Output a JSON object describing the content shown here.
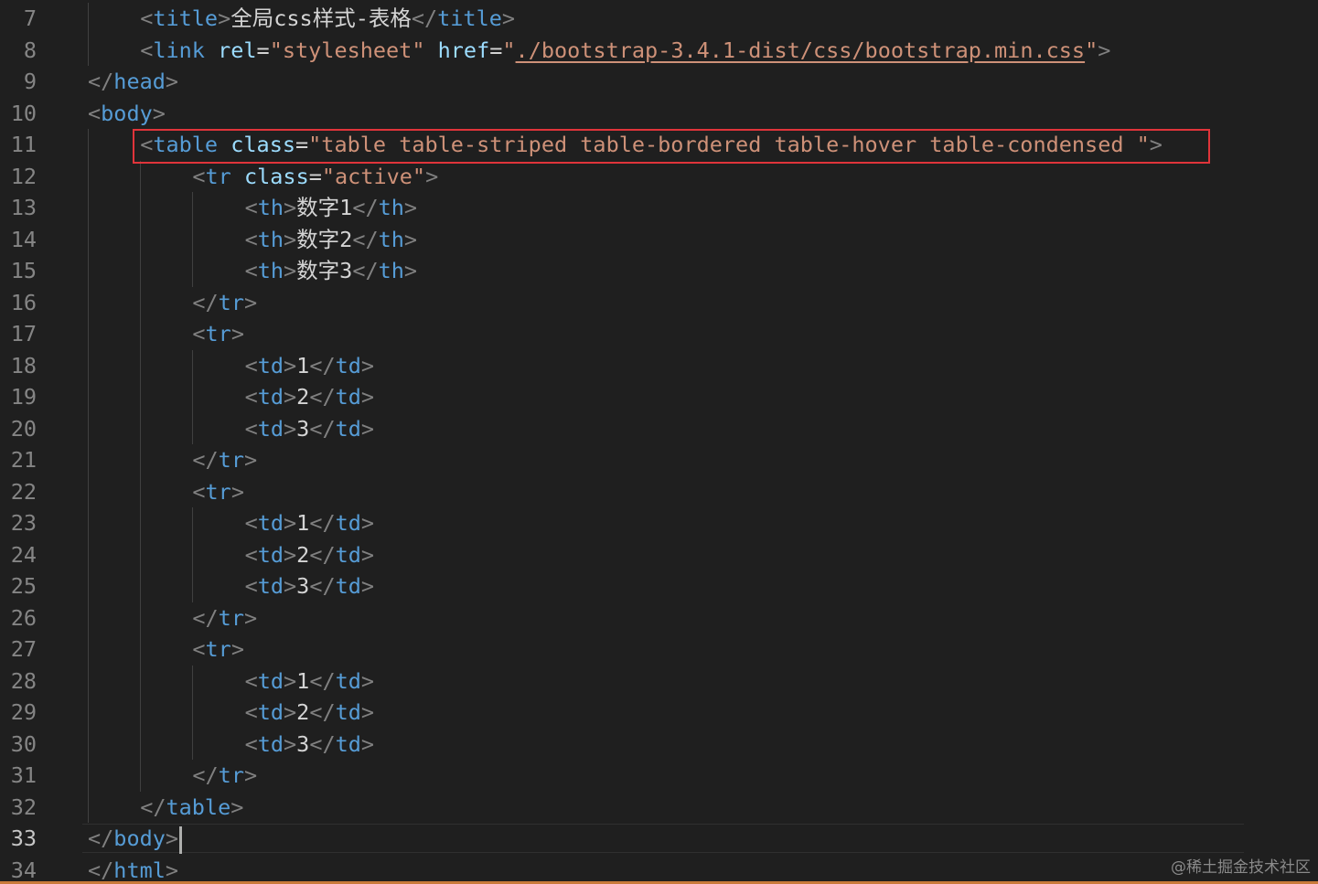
{
  "editor": {
    "current_line": "33",
    "lines": [
      {
        "n": "7",
        "indent": 1,
        "guides": 1,
        "tokens": [
          [
            "punct",
            "<"
          ],
          [
            "tag",
            "title"
          ],
          [
            "punct",
            ">"
          ],
          [
            "txt",
            "全局css样式-表格"
          ],
          [
            "punct",
            "</"
          ],
          [
            "tag",
            "title"
          ],
          [
            "punct",
            ">"
          ]
        ]
      },
      {
        "n": "8",
        "indent": 1,
        "guides": 1,
        "tokens": [
          [
            "punct",
            "<"
          ],
          [
            "tag",
            "link"
          ],
          [
            "txt",
            " "
          ],
          [
            "attr",
            "rel"
          ],
          [
            "eq",
            "="
          ],
          [
            "str",
            "\"stylesheet\""
          ],
          [
            "txt",
            " "
          ],
          [
            "attr",
            "href"
          ],
          [
            "eq",
            "="
          ],
          [
            "str",
            "\""
          ],
          [
            "link",
            "./bootstrap-3.4.1-dist/css/bootstrap.min.css"
          ],
          [
            "str",
            "\""
          ],
          [
            "punct",
            ">"
          ]
        ]
      },
      {
        "n": "9",
        "indent": 0,
        "guides": 0,
        "tokens": [
          [
            "punct",
            "</"
          ],
          [
            "tag",
            "head"
          ],
          [
            "punct",
            ">"
          ]
        ]
      },
      {
        "n": "10",
        "indent": 0,
        "guides": 0,
        "tokens": [
          [
            "punct",
            "<"
          ],
          [
            "tag",
            "body"
          ],
          [
            "punct",
            ">"
          ]
        ]
      },
      {
        "n": "11",
        "indent": 1,
        "guides": 1,
        "tokens": [
          [
            "punct",
            "<"
          ],
          [
            "tag",
            "table"
          ],
          [
            "txt",
            " "
          ],
          [
            "attr",
            "class"
          ],
          [
            "eq",
            "="
          ],
          [
            "str",
            "\"table table-striped table-bordered table-hover table-condensed \""
          ],
          [
            "punct",
            ">"
          ]
        ]
      },
      {
        "n": "12",
        "indent": 2,
        "guides": 2,
        "tokens": [
          [
            "punct",
            "<"
          ],
          [
            "tag",
            "tr"
          ],
          [
            "txt",
            " "
          ],
          [
            "attr",
            "class"
          ],
          [
            "eq",
            "="
          ],
          [
            "str",
            "\"active\""
          ],
          [
            "punct",
            ">"
          ]
        ]
      },
      {
        "n": "13",
        "indent": 3,
        "guides": 3,
        "tokens": [
          [
            "punct",
            "<"
          ],
          [
            "tag",
            "th"
          ],
          [
            "punct",
            ">"
          ],
          [
            "txt",
            "数字1"
          ],
          [
            "punct",
            "</"
          ],
          [
            "tag",
            "th"
          ],
          [
            "punct",
            ">"
          ]
        ]
      },
      {
        "n": "14",
        "indent": 3,
        "guides": 3,
        "tokens": [
          [
            "punct",
            "<"
          ],
          [
            "tag",
            "th"
          ],
          [
            "punct",
            ">"
          ],
          [
            "txt",
            "数字2"
          ],
          [
            "punct",
            "</"
          ],
          [
            "tag",
            "th"
          ],
          [
            "punct",
            ">"
          ]
        ]
      },
      {
        "n": "15",
        "indent": 3,
        "guides": 3,
        "tokens": [
          [
            "punct",
            "<"
          ],
          [
            "tag",
            "th"
          ],
          [
            "punct",
            ">"
          ],
          [
            "txt",
            "数字3"
          ],
          [
            "punct",
            "</"
          ],
          [
            "tag",
            "th"
          ],
          [
            "punct",
            ">"
          ]
        ]
      },
      {
        "n": "16",
        "indent": 2,
        "guides": 2,
        "tokens": [
          [
            "punct",
            "</"
          ],
          [
            "tag",
            "tr"
          ],
          [
            "punct",
            ">"
          ]
        ]
      },
      {
        "n": "17",
        "indent": 2,
        "guides": 2,
        "tokens": [
          [
            "punct",
            "<"
          ],
          [
            "tag",
            "tr"
          ],
          [
            "punct",
            ">"
          ]
        ]
      },
      {
        "n": "18",
        "indent": 3,
        "guides": 3,
        "tokens": [
          [
            "punct",
            "<"
          ],
          [
            "tag",
            "td"
          ],
          [
            "punct",
            ">"
          ],
          [
            "txt",
            "1"
          ],
          [
            "punct",
            "</"
          ],
          [
            "tag",
            "td"
          ],
          [
            "punct",
            ">"
          ]
        ]
      },
      {
        "n": "19",
        "indent": 3,
        "guides": 3,
        "tokens": [
          [
            "punct",
            "<"
          ],
          [
            "tag",
            "td"
          ],
          [
            "punct",
            ">"
          ],
          [
            "txt",
            "2"
          ],
          [
            "punct",
            "</"
          ],
          [
            "tag",
            "td"
          ],
          [
            "punct",
            ">"
          ]
        ]
      },
      {
        "n": "20",
        "indent": 3,
        "guides": 3,
        "tokens": [
          [
            "punct",
            "<"
          ],
          [
            "tag",
            "td"
          ],
          [
            "punct",
            ">"
          ],
          [
            "txt",
            "3"
          ],
          [
            "punct",
            "</"
          ],
          [
            "tag",
            "td"
          ],
          [
            "punct",
            ">"
          ]
        ]
      },
      {
        "n": "21",
        "indent": 2,
        "guides": 2,
        "tokens": [
          [
            "punct",
            "</"
          ],
          [
            "tag",
            "tr"
          ],
          [
            "punct",
            ">"
          ]
        ]
      },
      {
        "n": "22",
        "indent": 2,
        "guides": 2,
        "tokens": [
          [
            "punct",
            "<"
          ],
          [
            "tag",
            "tr"
          ],
          [
            "punct",
            ">"
          ]
        ]
      },
      {
        "n": "23",
        "indent": 3,
        "guides": 3,
        "tokens": [
          [
            "punct",
            "<"
          ],
          [
            "tag",
            "td"
          ],
          [
            "punct",
            ">"
          ],
          [
            "txt",
            "1"
          ],
          [
            "punct",
            "</"
          ],
          [
            "tag",
            "td"
          ],
          [
            "punct",
            ">"
          ]
        ]
      },
      {
        "n": "24",
        "indent": 3,
        "guides": 3,
        "tokens": [
          [
            "punct",
            "<"
          ],
          [
            "tag",
            "td"
          ],
          [
            "punct",
            ">"
          ],
          [
            "txt",
            "2"
          ],
          [
            "punct",
            "</"
          ],
          [
            "tag",
            "td"
          ],
          [
            "punct",
            ">"
          ]
        ]
      },
      {
        "n": "25",
        "indent": 3,
        "guides": 3,
        "tokens": [
          [
            "punct",
            "<"
          ],
          [
            "tag",
            "td"
          ],
          [
            "punct",
            ">"
          ],
          [
            "txt",
            "3"
          ],
          [
            "punct",
            "</"
          ],
          [
            "tag",
            "td"
          ],
          [
            "punct",
            ">"
          ]
        ]
      },
      {
        "n": "26",
        "indent": 2,
        "guides": 2,
        "tokens": [
          [
            "punct",
            "</"
          ],
          [
            "tag",
            "tr"
          ],
          [
            "punct",
            ">"
          ]
        ]
      },
      {
        "n": "27",
        "indent": 2,
        "guides": 2,
        "tokens": [
          [
            "punct",
            "<"
          ],
          [
            "tag",
            "tr"
          ],
          [
            "punct",
            ">"
          ]
        ]
      },
      {
        "n": "28",
        "indent": 3,
        "guides": 3,
        "tokens": [
          [
            "punct",
            "<"
          ],
          [
            "tag",
            "td"
          ],
          [
            "punct",
            ">"
          ],
          [
            "txt",
            "1"
          ],
          [
            "punct",
            "</"
          ],
          [
            "tag",
            "td"
          ],
          [
            "punct",
            ">"
          ]
        ]
      },
      {
        "n": "29",
        "indent": 3,
        "guides": 3,
        "tokens": [
          [
            "punct",
            "<"
          ],
          [
            "tag",
            "td"
          ],
          [
            "punct",
            ">"
          ],
          [
            "txt",
            "2"
          ],
          [
            "punct",
            "</"
          ],
          [
            "tag",
            "td"
          ],
          [
            "punct",
            ">"
          ]
        ]
      },
      {
        "n": "30",
        "indent": 3,
        "guides": 3,
        "tokens": [
          [
            "punct",
            "<"
          ],
          [
            "tag",
            "td"
          ],
          [
            "punct",
            ">"
          ],
          [
            "txt",
            "3"
          ],
          [
            "punct",
            "</"
          ],
          [
            "tag",
            "td"
          ],
          [
            "punct",
            ">"
          ]
        ]
      },
      {
        "n": "31",
        "indent": 2,
        "guides": 2,
        "tokens": [
          [
            "punct",
            "</"
          ],
          [
            "tag",
            "tr"
          ],
          [
            "punct",
            ">"
          ]
        ]
      },
      {
        "n": "32",
        "indent": 1,
        "guides": 1,
        "tokens": [
          [
            "punct",
            "</"
          ],
          [
            "tag",
            "table"
          ],
          [
            "punct",
            ">"
          ]
        ]
      },
      {
        "n": "33",
        "indent": 0,
        "guides": 0,
        "tokens": [
          [
            "punct",
            "</"
          ],
          [
            "tag",
            "body"
          ],
          [
            "punct",
            ">"
          ]
        ]
      },
      {
        "n": "34",
        "indent": 0,
        "guides": 0,
        "tokens": [
          [
            "punct",
            "</"
          ],
          [
            "tag",
            "html"
          ],
          [
            "punct",
            ">"
          ]
        ]
      }
    ]
  },
  "annotation": {
    "highlight_line": "11",
    "highlight_color": "#e0343a"
  },
  "watermark": {
    "text": "@稀土掘金技术社区"
  }
}
